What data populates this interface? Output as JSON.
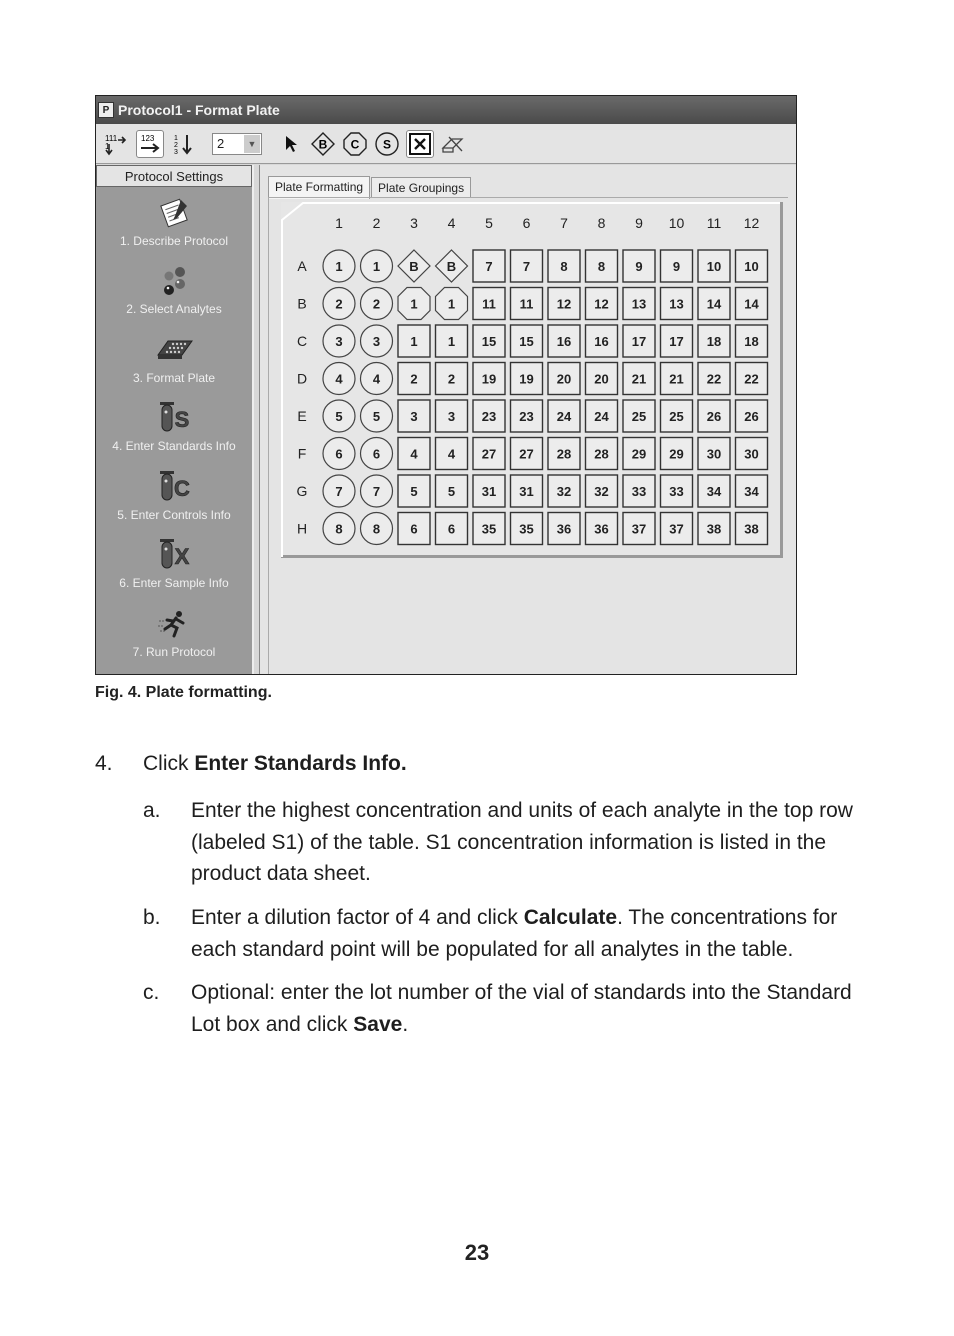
{
  "window": {
    "title": "Protocol1  - Format Plate",
    "app_icon": "document-icon"
  },
  "toolbar": {
    "buttons": [
      {
        "name": "fill-down-right-icon",
        "glyph": "111↓→"
      },
      {
        "name": "fill-across-icon",
        "glyph": "123→",
        "pressed": true
      },
      {
        "name": "fill-down-icon",
        "glyph": "123↓"
      }
    ],
    "replicate_select": {
      "value": "2"
    },
    "tools": [
      {
        "name": "pointer-icon"
      },
      {
        "name": "blank-tool-icon",
        "letter": "B"
      },
      {
        "name": "control-tool-icon",
        "letter": "C"
      },
      {
        "name": "standard-tool-icon",
        "letter": "S"
      },
      {
        "name": "clear-well-icon",
        "letter": "X",
        "pressed": true
      },
      {
        "name": "eraser-icon"
      }
    ]
  },
  "sidebar": {
    "header": "Protocol Settings",
    "steps": [
      {
        "label": "1. Describe Protocol",
        "icon": "notepad-icon"
      },
      {
        "label": "2. Select Analytes",
        "icon": "beads-icon"
      },
      {
        "label": "3. Format Plate",
        "icon": "plate-icon"
      },
      {
        "label": "4. Enter Standards Info",
        "icon": "standards-tube-icon",
        "letter": "S"
      },
      {
        "label": "5. Enter Controls Info",
        "icon": "controls-tube-icon",
        "letter": "C"
      },
      {
        "label": "6. Enter Sample Info",
        "icon": "sample-tube-icon",
        "letter": "X"
      },
      {
        "label": "7. Run Protocol",
        "icon": "runner-icon"
      }
    ]
  },
  "tabs": [
    {
      "label": "Plate Formatting",
      "active": true
    },
    {
      "label": "Plate Groupings",
      "active": false
    }
  ],
  "plate": {
    "columns": [
      "1",
      "2",
      "3",
      "4",
      "5",
      "6",
      "7",
      "8",
      "9",
      "10",
      "11",
      "12"
    ],
    "rows": [
      "A",
      "B",
      "C",
      "D",
      "E",
      "F",
      "G",
      "H"
    ],
    "legend": {
      "circle": "standard",
      "diamond": "blank",
      "octagon": "control",
      "square": "sample"
    },
    "wells": [
      [
        [
          "circle",
          "1"
        ],
        [
          "circle",
          "1"
        ],
        [
          "diamond",
          "B"
        ],
        [
          "diamond",
          "B"
        ],
        [
          "square",
          "7"
        ],
        [
          "square",
          "7"
        ],
        [
          "square",
          "8"
        ],
        [
          "square",
          "8"
        ],
        [
          "square",
          "9"
        ],
        [
          "square",
          "9"
        ],
        [
          "square",
          "10"
        ],
        [
          "square",
          "10"
        ]
      ],
      [
        [
          "circle",
          "2"
        ],
        [
          "circle",
          "2"
        ],
        [
          "octagon",
          "1"
        ],
        [
          "octagon",
          "1"
        ],
        [
          "square",
          "11"
        ],
        [
          "square",
          "11"
        ],
        [
          "square",
          "12"
        ],
        [
          "square",
          "12"
        ],
        [
          "square",
          "13"
        ],
        [
          "square",
          "13"
        ],
        [
          "square",
          "14"
        ],
        [
          "square",
          "14"
        ]
      ],
      [
        [
          "circle",
          "3"
        ],
        [
          "circle",
          "3"
        ],
        [
          "square",
          "1"
        ],
        [
          "square",
          "1"
        ],
        [
          "square",
          "15"
        ],
        [
          "square",
          "15"
        ],
        [
          "square",
          "16"
        ],
        [
          "square",
          "16"
        ],
        [
          "square",
          "17"
        ],
        [
          "square",
          "17"
        ],
        [
          "square",
          "18"
        ],
        [
          "square",
          "18"
        ]
      ],
      [
        [
          "circle",
          "4"
        ],
        [
          "circle",
          "4"
        ],
        [
          "square",
          "2"
        ],
        [
          "square",
          "2"
        ],
        [
          "square",
          "19"
        ],
        [
          "square",
          "19"
        ],
        [
          "square",
          "20"
        ],
        [
          "square",
          "20"
        ],
        [
          "square",
          "21"
        ],
        [
          "square",
          "21"
        ],
        [
          "square",
          "22"
        ],
        [
          "square",
          "22"
        ]
      ],
      [
        [
          "circle",
          "5"
        ],
        [
          "circle",
          "5"
        ],
        [
          "square",
          "3"
        ],
        [
          "square",
          "3"
        ],
        [
          "square",
          "23"
        ],
        [
          "square",
          "23"
        ],
        [
          "square",
          "24"
        ],
        [
          "square",
          "24"
        ],
        [
          "square",
          "25"
        ],
        [
          "square",
          "25"
        ],
        [
          "square",
          "26"
        ],
        [
          "square",
          "26"
        ]
      ],
      [
        [
          "circle",
          "6"
        ],
        [
          "circle",
          "6"
        ],
        [
          "square",
          "4"
        ],
        [
          "square",
          "4"
        ],
        [
          "square",
          "27"
        ],
        [
          "square",
          "27"
        ],
        [
          "square",
          "28"
        ],
        [
          "square",
          "28"
        ],
        [
          "square",
          "29"
        ],
        [
          "square",
          "29"
        ],
        [
          "square",
          "30"
        ],
        [
          "square",
          "30"
        ]
      ],
      [
        [
          "circle",
          "7"
        ],
        [
          "circle",
          "7"
        ],
        [
          "square",
          "5"
        ],
        [
          "square",
          "5"
        ],
        [
          "square",
          "31"
        ],
        [
          "square",
          "31"
        ],
        [
          "square",
          "32"
        ],
        [
          "square",
          "32"
        ],
        [
          "square",
          "33"
        ],
        [
          "square",
          "33"
        ],
        [
          "square",
          "34"
        ],
        [
          "square",
          "34"
        ]
      ],
      [
        [
          "circle",
          "8"
        ],
        [
          "circle",
          "8"
        ],
        [
          "square",
          "6"
        ],
        [
          "square",
          "6"
        ],
        [
          "square",
          "35"
        ],
        [
          "square",
          "35"
        ],
        [
          "square",
          "36"
        ],
        [
          "square",
          "36"
        ],
        [
          "square",
          "37"
        ],
        [
          "square",
          "37"
        ],
        [
          "square",
          "38"
        ],
        [
          "square",
          "38"
        ]
      ]
    ]
  },
  "document": {
    "caption": "Fig. 4. Plate formatting.",
    "step_number": "4.",
    "step_prefix": "Click ",
    "step_bold": "Enter Standards Info.",
    "substeps": [
      {
        "letter": "a.",
        "parts": [
          {
            "t": "Enter the highest concentration and units of each analyte in the top row (labeled S1) of the table. S1 concentration information is listed in the product data sheet."
          }
        ]
      },
      {
        "letter": "b.",
        "parts": [
          {
            "t": "Enter a dilution factor of 4 and click "
          },
          {
            "t": "Calculate",
            "b": true
          },
          {
            "t": ". The concentrations for each standard point will be populated for all analytes in the table."
          }
        ]
      },
      {
        "letter": "c.",
        "parts": [
          {
            "t": "Optional: enter the lot number of the vial of standards into the Standard Lot box and click "
          },
          {
            "t": "Save",
            "b": true
          },
          {
            "t": "."
          }
        ]
      }
    ],
    "page_number": "23"
  }
}
